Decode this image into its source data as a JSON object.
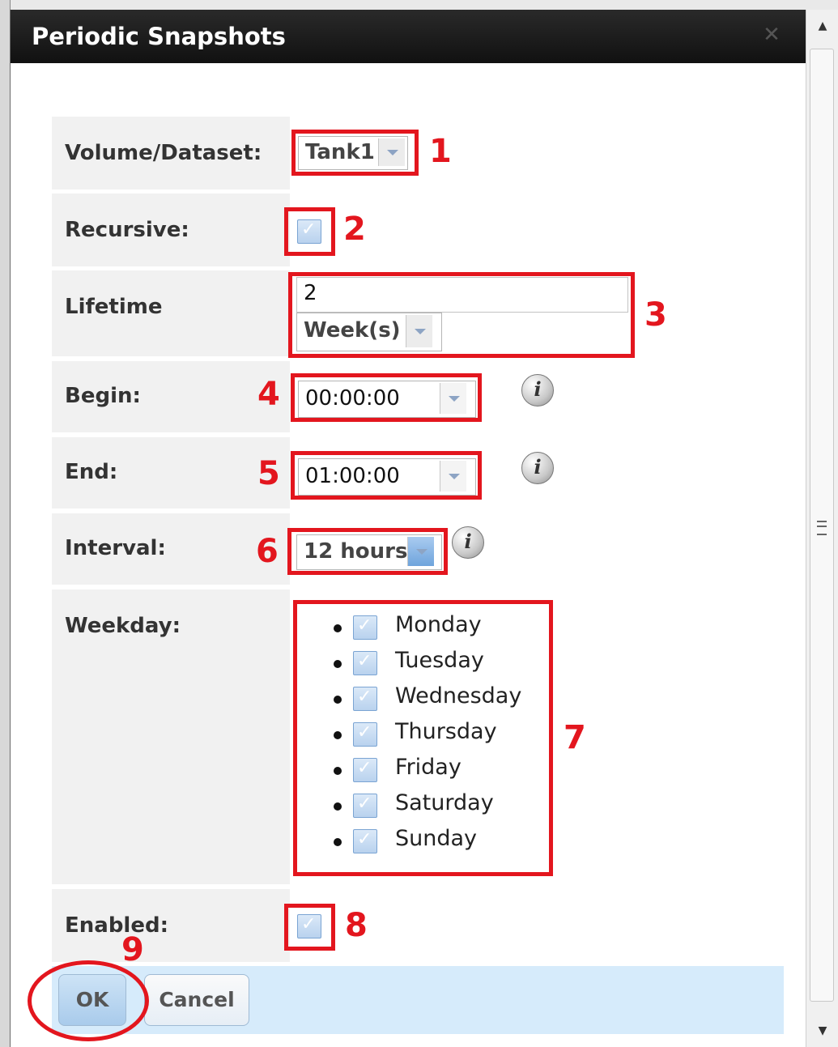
{
  "dialog": {
    "title": "Periodic Snapshots"
  },
  "form": {
    "volume_label": "Volume/Dataset:",
    "volume_value": "Tank1",
    "recursive_label": "Recursive:",
    "lifetime_label": "Lifetime",
    "lifetime_value": "2",
    "lifetime_unit": "Week(s)",
    "begin_label": "Begin:",
    "begin_value": "00:00:00",
    "end_label": "End:",
    "end_value": "01:00:00",
    "interval_label": "Interval:",
    "interval_value": "12 hours",
    "weekday_label": "Weekday:",
    "weekdays": [
      "Monday",
      "Tuesday",
      "Wednesday",
      "Thursday",
      "Friday",
      "Saturday",
      "Sunday"
    ],
    "enabled_label": "Enabled:"
  },
  "annotations": [
    "1",
    "2",
    "3",
    "4",
    "5",
    "6",
    "7",
    "8",
    "9"
  ],
  "buttons": {
    "ok": "OK",
    "cancel": "Cancel"
  },
  "icons": {
    "close": "close-icon",
    "info": "info-icon",
    "checkbox": "checked-checkbox"
  },
  "colors": {
    "annotation": "#e3161e",
    "titlebar": "#1a1a1a",
    "footer": "#d6ebfb",
    "label_bg": "#f1f1f1"
  }
}
